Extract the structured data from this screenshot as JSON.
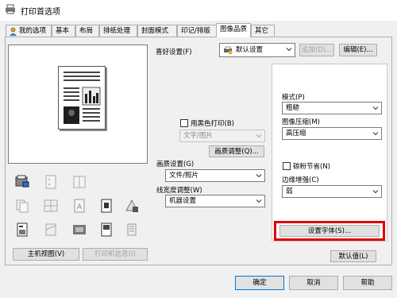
{
  "window": {
    "title": "打印首选项"
  },
  "tabs": [
    {
      "label": "我的选项"
    },
    {
      "label": "基本"
    },
    {
      "label": "布局"
    },
    {
      "label": "排纸处理"
    },
    {
      "label": "封面模式"
    },
    {
      "label": "印记/排版"
    },
    {
      "label": "图像品质"
    },
    {
      "label": "其它"
    }
  ],
  "favorites": {
    "label": "喜好设置(F)",
    "selected": "默认设置",
    "add_label": "追加(D)...",
    "edit_label": "编辑(E)..."
  },
  "quality": {
    "black_print_label": "用黑色打印(B)",
    "black_print_checked": false,
    "text_image_value": "文字/图片",
    "adjust_label": "画质调整(Q)...",
    "settings_label": "画质设置(G)",
    "settings_value": "文件/照片",
    "line_width_label": "线宽度调整(W)",
    "line_width_value": "机器设置"
  },
  "right": {
    "mode_label": "模式(P)",
    "mode_value": "粗糙",
    "compression_label": "图像压缩(M)",
    "compression_value": "高压缩",
    "toner_save_label": "碳粉节省(N)",
    "toner_save_checked": false,
    "edge_label": "边缘增强(C)",
    "edge_value": "弱",
    "font_settings_label": "设置字体(S)..."
  },
  "left_buttons": {
    "main_view": "主机视图(V)",
    "printer_info": "打印机信息(I)"
  },
  "default_button": "默认值(L)",
  "footer": {
    "ok": "确定",
    "cancel": "取消",
    "help": "帮助"
  }
}
